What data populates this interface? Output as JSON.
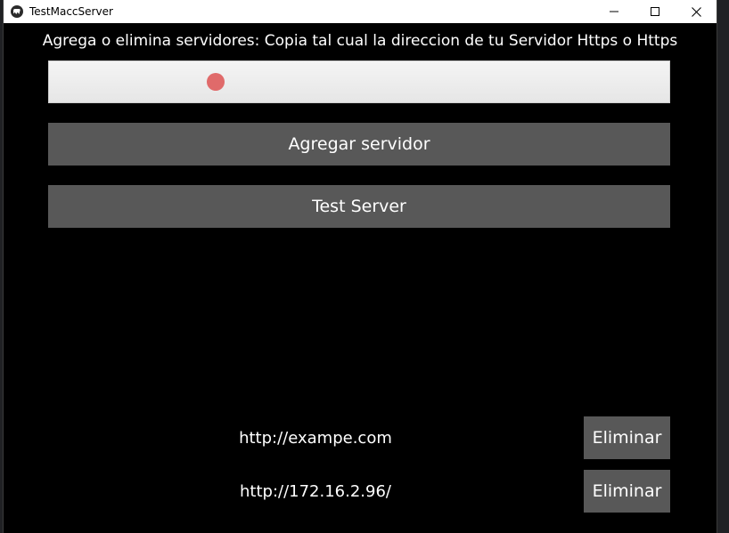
{
  "window": {
    "title": "TestMaccServer"
  },
  "instruction": "Agrega o elimina servidores: Copia tal cual la direccion de tu Servidor Https o Https",
  "url_input": {
    "value": "",
    "placeholder": ""
  },
  "buttons": {
    "add_server": "Agregar servidor",
    "test_server": "Test Server"
  },
  "servers": [
    {
      "url": "http://exampe.com",
      "delete_label": "Eliminar"
    },
    {
      "url": "http://172.16.2.96/",
      "delete_label": "Eliminar"
    }
  ],
  "colors": {
    "background": "#000000",
    "button": "#585858",
    "touch_indicator": "#e06a6a"
  }
}
